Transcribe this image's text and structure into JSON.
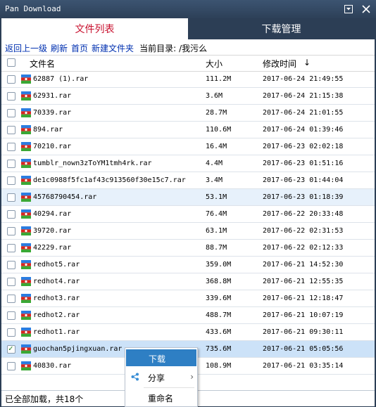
{
  "window": {
    "title": "Pan Download"
  },
  "tabs": [
    {
      "label": "文件列表",
      "active": true
    },
    {
      "label": "下载管理",
      "active": false
    }
  ],
  "toolbar": {
    "back_label": "返回上一级",
    "refresh_label": "刷新",
    "home_label": "首页",
    "new_folder_label": "新建文件夹",
    "current_dir_label": "当前目录:",
    "current_dir_value": "/我污么"
  },
  "table": {
    "headers": {
      "name": "文件名",
      "size": "大小",
      "time": "修改时间",
      "sort_indicator": "↓"
    },
    "rows": [
      {
        "name": "62887 (1).rar",
        "size": "111.2M",
        "time": "2017-06-24 21:49:55",
        "checked": false
      },
      {
        "name": "62931.rar",
        "size": "3.6M",
        "time": "2017-06-24 21:15:38",
        "checked": false
      },
      {
        "name": "70339.rar",
        "size": "28.7M",
        "time": "2017-06-24 21:01:55",
        "checked": false
      },
      {
        "name": "894.rar",
        "size": "110.6M",
        "time": "2017-06-24 01:39:46",
        "checked": false
      },
      {
        "name": "70210.rar",
        "size": "16.4M",
        "time": "2017-06-23 02:02:18",
        "checked": false
      },
      {
        "name": "tumblr_nown3zToYM1tmh4rk.rar",
        "size": "4.4M",
        "time": "2017-06-23 01:51:16",
        "checked": false
      },
      {
        "name": "de1c0988f5fc1af43c913560f30e15c7.rar",
        "size": "3.4M",
        "time": "2017-06-23 01:44:04",
        "checked": false
      },
      {
        "name": "45768790454.rar",
        "size": "53.1M",
        "time": "2017-06-23 01:18:39",
        "checked": false
      },
      {
        "name": "40294.rar",
        "size": "76.4M",
        "time": "2017-06-22 20:33:48",
        "checked": false
      },
      {
        "name": "39720.rar",
        "size": "63.1M",
        "time": "2017-06-22 02:31:53",
        "checked": false
      },
      {
        "name": "42229.rar",
        "size": "88.7M",
        "time": "2017-06-22 02:12:33",
        "checked": false
      },
      {
        "name": "redhot5.rar",
        "size": "359.0M",
        "time": "2017-06-21 14:52:30",
        "checked": false
      },
      {
        "name": "redhot4.rar",
        "size": "368.8M",
        "time": "2017-06-21 12:55:35",
        "checked": false
      },
      {
        "name": "redhot3.rar",
        "size": "339.6M",
        "time": "2017-06-21 12:18:47",
        "checked": false
      },
      {
        "name": "redhot2.rar",
        "size": "488.7M",
        "time": "2017-06-21 10:07:19",
        "checked": false
      },
      {
        "name": "redhot1.rar",
        "size": "433.6M",
        "time": "2017-06-21 09:30:11",
        "checked": false
      },
      {
        "name": "guochan5pjingxuan.rar",
        "size": "735.6M",
        "time": "2017-06-21 05:05:56",
        "checked": true
      },
      {
        "name": "40830.rar",
        "size": "108.9M",
        "time": "2017-06-21 03:35:14",
        "checked": false
      }
    ]
  },
  "status": {
    "text": "已全部加载，共18个"
  },
  "context_menu": {
    "items": [
      {
        "label": "下载",
        "icon": ""
      },
      {
        "label": "分享",
        "icon": "share-icon",
        "submenu": "›"
      },
      {
        "label": "重命名",
        "icon": ""
      }
    ]
  },
  "colors": {
    "window_frame": "#2c3e55",
    "active_tab_text": "#c8102e",
    "link_text": "#0030b0",
    "menu_highlight": "#2e7fc4",
    "selected_row": "#cce2f8",
    "hover_row": "#e7f1fb"
  }
}
